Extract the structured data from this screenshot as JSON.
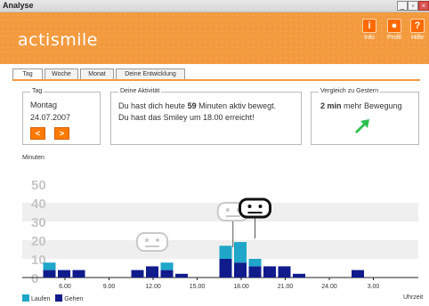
{
  "window": {
    "title": "Analyse"
  },
  "header": {
    "logo": "actismile",
    "buttons": [
      {
        "icon": "info-icon",
        "glyph": "i",
        "label": "Info"
      },
      {
        "icon": "profile-icon",
        "glyph": "●",
        "label": "Profil"
      },
      {
        "icon": "help-icon",
        "glyph": "?",
        "label": "Hilfe"
      }
    ]
  },
  "tabs": [
    "Tag",
    "Woche",
    "Monat",
    "Deine Entwicklung"
  ],
  "active_tab": "Tag",
  "day_box": {
    "legend": "Tag",
    "weekday": "Montag",
    "date": "24.07.2007",
    "prev": "<",
    "next": ">"
  },
  "activity_box": {
    "legend": "Deine Aktivität",
    "line1_pre": "Du hast dich heute ",
    "line1_bold": "59",
    "line1_post": " Minuten aktiv bewegt.",
    "line2": "Du hast das Smiley um 18.00 erreicht!"
  },
  "compare_box": {
    "legend": "Vergleich zu Gestern",
    "bold": "2 min",
    "text": " mehr Bewegung"
  },
  "chart_labels": {
    "y_unit": "Minuten",
    "x_unit": "Uhrzeit"
  },
  "colors": {
    "accent": "#f39a3e",
    "laufen": "#1fa6c8",
    "gehen": "#101c8c",
    "arrow": "#2fbf4f"
  },
  "chart_data": {
    "type": "bar",
    "stacked": true,
    "ylim": [
      0,
      50
    ],
    "yticks": [
      0,
      10,
      20,
      30,
      40,
      50
    ],
    "xticks": [
      "6.00",
      "9.00",
      "12.00",
      "15.00",
      "18.00",
      "21.00",
      "24.00",
      "3.00"
    ],
    "x": [
      5,
      6,
      7,
      11,
      12,
      13,
      14,
      15,
      17,
      18,
      19,
      20,
      21,
      22,
      26
    ],
    "series": [
      {
        "name": "Gehen",
        "values": [
          4,
          4,
          4,
          4,
          6,
          4,
          2,
          0,
          10,
          8,
          6,
          6,
          6,
          2,
          4
        ]
      },
      {
        "name": "Laufen",
        "values": [
          4,
          0,
          0,
          0,
          0,
          4,
          0,
          0,
          7,
          11,
          4,
          0,
          0,
          0,
          0
        ]
      }
    ],
    "legend": [
      "Laufen",
      "Gehen"
    ],
    "smileys": [
      {
        "hour": 12,
        "state": "inactive"
      },
      {
        "hour": 17.5,
        "state": "inactive"
      },
      {
        "hour": 19,
        "state": "active"
      }
    ]
  }
}
